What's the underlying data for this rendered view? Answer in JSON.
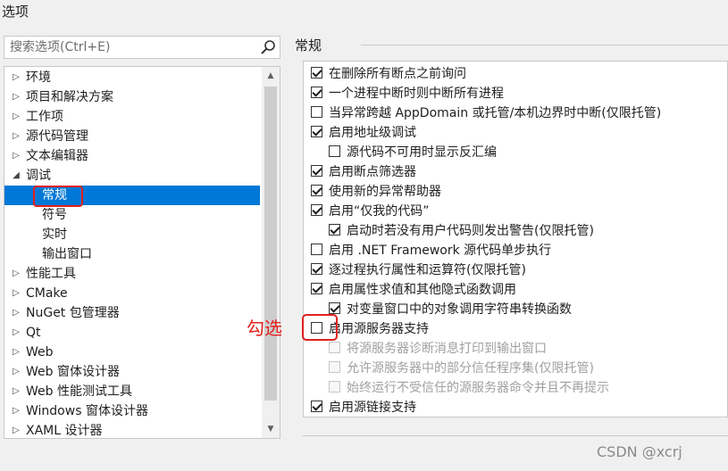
{
  "dialog": {
    "title": "选项"
  },
  "search": {
    "placeholder": "搜索选项(Ctrl+E)",
    "value": ""
  },
  "tree": {
    "items": [
      {
        "label": "环境"
      },
      {
        "label": "项目和解决方案"
      },
      {
        "label": "工作项"
      },
      {
        "label": "源代码管理"
      },
      {
        "label": "文本编辑器"
      },
      {
        "label": "调试"
      },
      {
        "label": "常规"
      },
      {
        "label": "符号"
      },
      {
        "label": "实时"
      },
      {
        "label": "输出窗口"
      },
      {
        "label": "性能工具"
      },
      {
        "label": "CMake"
      },
      {
        "label": "NuGet 包管理器"
      },
      {
        "label": "Qt"
      },
      {
        "label": "Web"
      },
      {
        "label": "Web 窗体设计器"
      },
      {
        "label": "Web 性能测试工具"
      },
      {
        "label": "Windows 窗体设计器"
      },
      {
        "label": "XAML 设计器"
      }
    ]
  },
  "section": {
    "title": "常规"
  },
  "options": [
    {
      "label": "在删除所有断点之前询问",
      "checked": true
    },
    {
      "label": "一个进程中断时则中断所有进程",
      "checked": true
    },
    {
      "label": "当异常跨越 AppDomain 或托管/本机边界时中断(仅限托管)",
      "checked": false
    },
    {
      "label": "启用地址级调试",
      "checked": true
    },
    {
      "label": "源代码不可用时显示反汇编",
      "checked": false
    },
    {
      "label": "启用断点筛选器",
      "checked": true
    },
    {
      "label": "使用新的异常帮助器",
      "checked": true
    },
    {
      "label": "启用“仅我的代码”",
      "checked": true
    },
    {
      "label": "启动时若没有用户代码则发出警告(仅限托管)",
      "checked": true
    },
    {
      "label": "启用 .NET Framework 源代码单步执行",
      "checked": false
    },
    {
      "label": "逐过程执行属性和运算符(仅限托管)",
      "checked": true
    },
    {
      "label": "启用属性求值和其他隐式函数调用",
      "checked": true
    },
    {
      "label": "对变量窗口中的对象调用字符串转换函数",
      "checked": true
    },
    {
      "label": "启用源服务器支持",
      "checked": false
    },
    {
      "label": "将源服务器诊断消息打印到输出窗口",
      "checked": false,
      "disabled": true
    },
    {
      "label": "允许源服务器中的部分信任程序集(仅限托管)",
      "checked": false,
      "disabled": true
    },
    {
      "label": "始终运行不受信任的源服务器命令并且不再提示",
      "checked": false,
      "disabled": true
    },
    {
      "label": "启用源链接支持",
      "checked": true
    }
  ],
  "annotation": {
    "text": "勾选"
  },
  "watermark": {
    "text": "CSDN @xcrj"
  },
  "colors": {
    "selection": "#0078d7",
    "annotation": "#e0201d"
  }
}
